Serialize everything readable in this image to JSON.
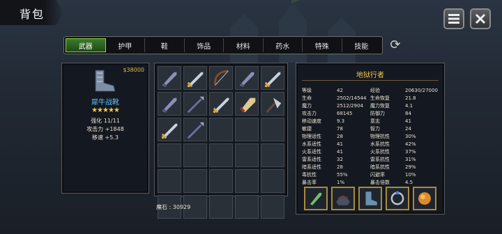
{
  "header": {
    "title": "背包"
  },
  "tabs": [
    "武器",
    "护甲",
    "鞋",
    "饰品",
    "材料",
    "药水",
    "特殊",
    "技能"
  ],
  "item": {
    "price": "$38000",
    "name": "犀牛战靴",
    "stars": "★★★★★",
    "enhance": "强化 11/11",
    "attack": "攻击力 +1848",
    "speed": "移速 +5.3"
  },
  "inventory": {
    "gems_label": "魔石 : 30929",
    "slots": [
      "dagger",
      "sword",
      "bow",
      "dagger",
      "sword",
      "dagger",
      "spear",
      "sword",
      "blade",
      "axe",
      "sword",
      "spear",
      "",
      "",
      "",
      "",
      "",
      "",
      "",
      "",
      "",
      "",
      "",
      "",
      "",
      "",
      "",
      "",
      "",
      ""
    ]
  },
  "character": {
    "title": "地狱行者",
    "stats": [
      [
        "等级",
        "42",
        "经验",
        "20630/27000"
      ],
      [
        "生命",
        "2502/14544",
        "生命恢复",
        "21.8"
      ],
      [
        "魔力",
        "2512/2904",
        "魔力恢复",
        "4.1"
      ],
      [
        "攻击力",
        "68145",
        "防御力",
        "84"
      ],
      [
        "移动速度",
        "9.3",
        "意志",
        "41"
      ],
      [
        "敏捷",
        "78",
        "智力",
        "24"
      ],
      [
        "物理适性",
        "28",
        "物理抗性",
        "30%"
      ],
      [
        "水系适性",
        "41",
        "水系抗性",
        "42%"
      ],
      [
        "火系适性",
        "41",
        "火系抗性",
        "37%"
      ],
      [
        "雷系适性",
        "32",
        "雷系抗性",
        "31%"
      ],
      [
        "暗系适性",
        "28",
        "暗系抗性",
        "29%"
      ],
      [
        "毒抗性",
        "55%",
        "闪避率",
        "10%"
      ],
      [
        "暴击率",
        "1%",
        "暴击倍数",
        "4.5"
      ]
    ]
  },
  "equipment": [
    "dagger-icon",
    "helmet-icon",
    "boots-icon",
    "ring-icon",
    "fist-icon"
  ]
}
